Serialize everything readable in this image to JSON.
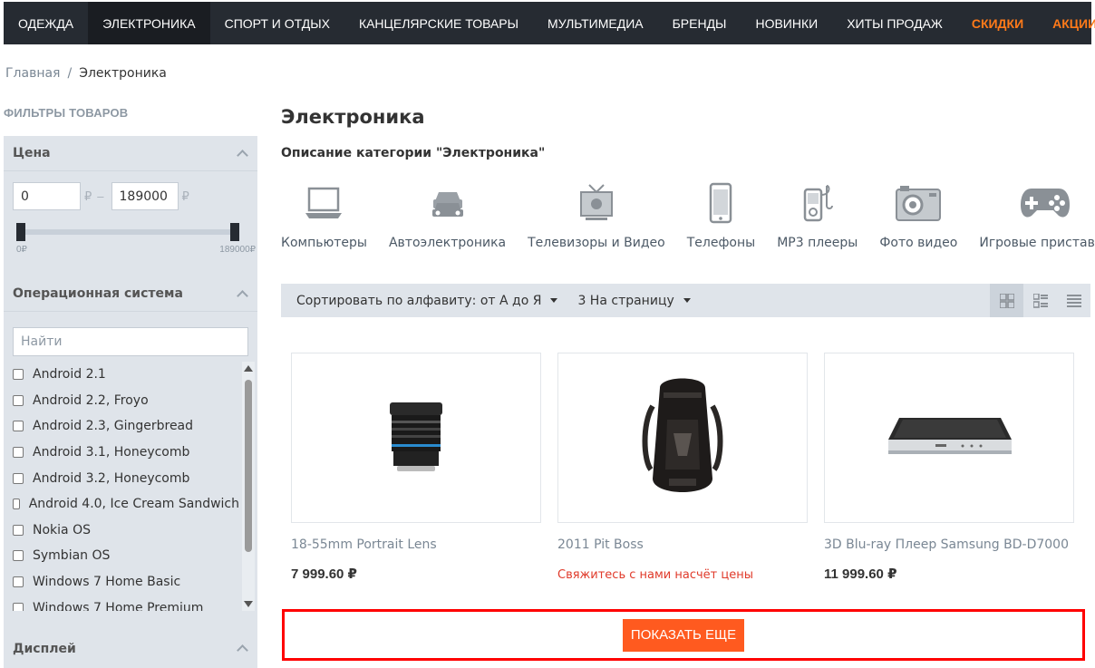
{
  "nav": {
    "items": [
      {
        "label": "ОДЕЖДА"
      },
      {
        "label": "ЭЛЕКТРОНИКА"
      },
      {
        "label": "СПОРТ И ОТДЫХ"
      },
      {
        "label": "КАНЦЕЛЯРСКИЕ ТОВАРЫ"
      },
      {
        "label": "МУЛЬТИМЕДИА"
      },
      {
        "label": "БРЕНДЫ"
      },
      {
        "label": "НОВИНКИ"
      },
      {
        "label": "ХИТЫ ПРОДАЖ"
      },
      {
        "label": "СКИДКИ"
      },
      {
        "label": "АКЦИИ"
      }
    ],
    "active_color": "#1a1d22",
    "accent_color": "#ff7a19"
  },
  "breadcrumb": {
    "home": "Главная",
    "sep": "/",
    "current": "Электроника"
  },
  "filters": {
    "title": "ФИЛЬТРЫ ТОВАРОВ",
    "price": {
      "title": "Цена",
      "min": "0",
      "max": "189000",
      "currency": "₽",
      "dash": "–",
      "range_min_label": "0₽",
      "range_max_label": "189000₽"
    },
    "os": {
      "title": "Операционная система",
      "search_placeholder": "Найти",
      "items": [
        "Android 2.1",
        "Android 2.2, Froyo",
        "Android 2.3, Gingerbread",
        "Android 3.1, Honeycomb",
        "Android 3.2, Honeycomb",
        "Android 4.0, Ice Cream Sandwich",
        "Nokia OS",
        "Symbian OS",
        "Windows 7 Home Basic",
        "Windows 7 Home Premium"
      ]
    },
    "display": {
      "title": "Дисплей"
    }
  },
  "main": {
    "title": "Электроника",
    "description": "Описание категории \"Электроника\"",
    "categories": [
      {
        "label": "Компьютеры",
        "icon": "laptop-icon"
      },
      {
        "label": "Автоэлектроника",
        "icon": "cars-icon"
      },
      {
        "label": "Телевизоры и Видео",
        "icon": "tv-icon"
      },
      {
        "label": "Телефоны",
        "icon": "phone-icon"
      },
      {
        "label": "MP3 плееры",
        "icon": "mp3-player-icon"
      },
      {
        "label": "Фото видео",
        "icon": "camera-icon"
      },
      {
        "label": "Игровые приставки",
        "icon": "gamepad-icon"
      }
    ],
    "sort_label": "Сортировать по алфавиту: от А до Я",
    "per_page_label": "3 На страницу",
    "views": [
      "grid-view-icon",
      "tile-list-view-icon",
      "list-view-icon"
    ],
    "products": [
      {
        "name": "18-55mm Portrait Lens",
        "price": "7 999.60 ₽",
        "image": "camera-lens"
      },
      {
        "name": "2011 Pit Boss",
        "contact": "Свяжитесь с нами насчёт цены",
        "image": "backpack"
      },
      {
        "name": "3D Blu-ray Плеер Samsung BD-D7000",
        "price": "11 999.60 ₽",
        "image": "bluray-player"
      }
    ],
    "show_more": "ПОКАЗАТЬ ЕЩЕ",
    "show_more_color": "#ff5a1f"
  }
}
